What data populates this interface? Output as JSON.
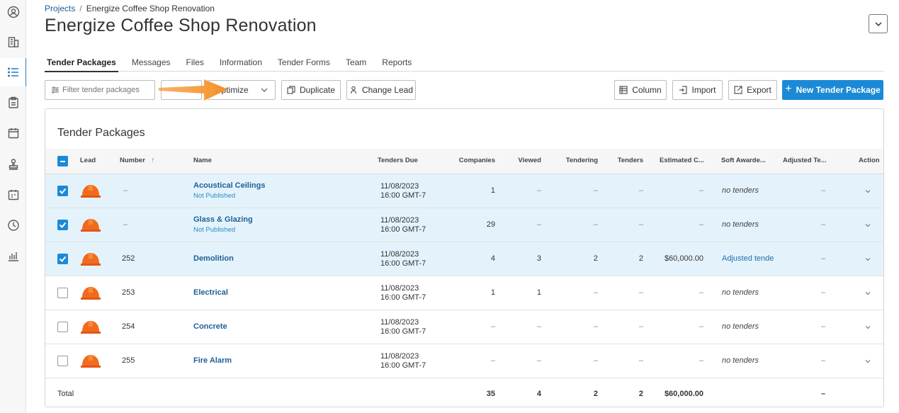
{
  "breadcrumb": {
    "root": "Projects",
    "separator": "/",
    "current": "Energize Coffee Shop Renovation"
  },
  "page_title": "Energize Coffee Shop Renovation",
  "rail_icons": [
    "profile-icon",
    "building-icon",
    "list-icon",
    "clipboard-icon",
    "calendar-icon",
    "stamp-icon",
    "schedule-icon",
    "clock-icon",
    "chart-icon"
  ],
  "tabs": [
    {
      "label": "Tender Packages",
      "active": true
    },
    {
      "label": "Messages"
    },
    {
      "label": "Files"
    },
    {
      "label": "Information"
    },
    {
      "label": "Tender Forms"
    },
    {
      "label": "Team"
    },
    {
      "label": "Reports"
    }
  ],
  "toolbar": {
    "filter_placeholder": "Filter tender packages",
    "optimize": "Optimize",
    "duplicate": "Duplicate",
    "change_lead": "Change Lead",
    "column": "Column",
    "import": "Import",
    "export": "Export",
    "new_package": "New Tender Package"
  },
  "table": {
    "title": "Tender Packages",
    "headers": {
      "lead": "Lead",
      "number": "Number",
      "sort_indicator": "↑",
      "name": "Name",
      "tenders_due": "Tenders Due",
      "companies": "Companies",
      "viewed": "Viewed",
      "tendering": "Tendering",
      "tenders": "Tenders",
      "estimated": "Estimated C...",
      "soft_awarded": "Soft Awarde...",
      "adjusted": "Adjusted Te...",
      "action": "Action"
    },
    "rows": [
      {
        "selected": true,
        "number": "–",
        "name": "Acoustical Ceilings",
        "status": "Not Published",
        "due_date": "11/08/2023",
        "due_time": "16:00 GMT-7",
        "companies": "1",
        "viewed": "–",
        "tendering": "–",
        "tenders": "–",
        "estimated": "–",
        "soft_awarded": "no tenders",
        "adjusted": "–"
      },
      {
        "selected": true,
        "number": "–",
        "name": "Glass & Glazing",
        "status": "Not Published",
        "due_date": "11/08/2023",
        "due_time": "16:00 GMT-7",
        "companies": "29",
        "viewed": "–",
        "tendering": "–",
        "tenders": "–",
        "estimated": "–",
        "soft_awarded": "no tenders",
        "adjusted": "–"
      },
      {
        "selected": true,
        "number": "252",
        "name": "Demolition",
        "status": "",
        "due_date": "11/08/2023",
        "due_time": "16:00 GMT-7",
        "companies": "4",
        "viewed": "3",
        "tendering": "2",
        "tenders": "2",
        "estimated": "$60,000.00",
        "soft_awarded": "Adjusted tende",
        "adjusted": "–"
      },
      {
        "selected": false,
        "number": "253",
        "name": "Electrical",
        "status": "",
        "due_date": "11/08/2023",
        "due_time": "16:00 GMT-7",
        "companies": "1",
        "viewed": "1",
        "tendering": "–",
        "tenders": "–",
        "estimated": "–",
        "soft_awarded": "no tenders",
        "adjusted": "–"
      },
      {
        "selected": false,
        "number": "254",
        "name": "Concrete",
        "status": "",
        "due_date": "11/08/2023",
        "due_time": "16:00 GMT-7",
        "companies": "–",
        "viewed": "–",
        "tendering": "–",
        "tenders": "–",
        "estimated": "–",
        "soft_awarded": "no tenders",
        "adjusted": "–"
      },
      {
        "selected": false,
        "number": "255",
        "name": "Fire Alarm",
        "status": "",
        "due_date": "11/08/2023",
        "due_time": "16:00 GMT-7",
        "companies": "–",
        "viewed": "–",
        "tendering": "–",
        "tenders": "–",
        "estimated": "–",
        "soft_awarded": "no tenders",
        "adjusted": "–"
      }
    ],
    "total": {
      "label": "Total",
      "companies": "35",
      "viewed": "4",
      "tendering": "2",
      "tenders": "2",
      "estimated": "$60,000.00",
      "adjusted": "–"
    }
  },
  "colors": {
    "accent": "#1b8ad6",
    "link": "#1f5f97",
    "selected_row": "#e4f3fb",
    "arrow": "#f5922b",
    "helmet": "#f26b1d"
  }
}
